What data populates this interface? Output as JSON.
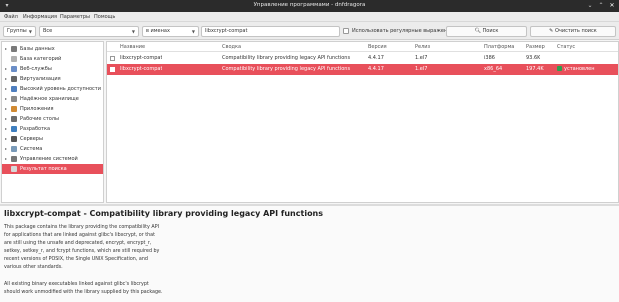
{
  "window": {
    "title": "Управление программами - dnfdragora"
  },
  "menu": [
    "Файл",
    "Информация",
    "Параметры",
    "Помощь"
  ],
  "toolbar": {
    "view_select": "Группы",
    "filter_select": "Все",
    "field_select": "в именах",
    "search_value": "libxcrypt-compat",
    "regex_label": "Использовать регулярные выражения",
    "search_button": "Поиск",
    "clear_button": "Очистить поиск"
  },
  "sidebar": {
    "items": [
      {
        "label": "Базы данных",
        "color": "#7a7a7a",
        "selected": false,
        "expand": true
      },
      {
        "label": "База категорий",
        "color": "#b0b0b0",
        "selected": false,
        "expand": false
      },
      {
        "label": "Веб-службы",
        "color": "#6b8ec7",
        "selected": false,
        "expand": true
      },
      {
        "label": "Виртуализация",
        "color": "#666666",
        "selected": false,
        "expand": true
      },
      {
        "label": "Высокий уровень доступности",
        "color": "#4f7fbf",
        "selected": false,
        "expand": true
      },
      {
        "label": "Надёжное хранилище",
        "color": "#8a8a8a",
        "selected": false,
        "expand": true
      },
      {
        "label": "Приложения",
        "color": "#d18a32",
        "selected": false,
        "expand": true
      },
      {
        "label": "Рабочие столы",
        "color": "#6c6c6c",
        "selected": false,
        "expand": true
      },
      {
        "label": "Разработка",
        "color": "#3f7fbf",
        "selected": false,
        "expand": true
      },
      {
        "label": "Серверы",
        "color": "#555555",
        "selected": false,
        "expand": true
      },
      {
        "label": "Система",
        "color": "#7a9ab8",
        "selected": false,
        "expand": true
      },
      {
        "label": "Управление системой",
        "color": "#777777",
        "selected": false,
        "expand": true
      },
      {
        "label": "Результат поиска",
        "color": "#d7d7d7",
        "selected": true,
        "expand": false
      }
    ]
  },
  "grid": {
    "headers": {
      "name": "Название",
      "summary": "Сводка",
      "version": "Версия",
      "release": "Релиз",
      "platform": "Платформа",
      "size": "Размер",
      "status": "Статус"
    },
    "rows": [
      {
        "name": "libxcrypt-compat",
        "summary": "Compatibility library providing legacy API functions",
        "version": "4.4.17",
        "release": "1.el7",
        "platform": "i386",
        "size": "93.6K",
        "status": "",
        "selected": false
      },
      {
        "name": "libxcrypt-compat",
        "summary": "Compatibility library providing legacy API functions",
        "version": "4.4.17",
        "release": "1.el7",
        "platform": "x86_64",
        "size": "197.4K",
        "status": "установлен",
        "selected": true
      }
    ]
  },
  "info": {
    "title": "libxcrypt-compat - Compatibility library providing legacy API functions",
    "para1": "This package contains the library providing the compatibility API for applications that are linked against glibc's libxcrypt, or that are still using the unsafe and deprecated, encrypt, encrypt_r, setkey, setkey_r, and fcrypt functions, which are still required by recent versions of POSIX, the Single UNIX Specification, and various other standards.",
    "para2": "All existing binary executables linked against glibc's libcrypt should work unmodified with the library supplied by this package."
  },
  "colors": {
    "accent": "#e8505b",
    "status_ok": "#2e9e4f"
  }
}
